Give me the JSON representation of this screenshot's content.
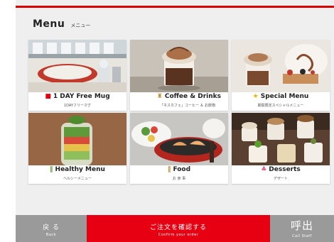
{
  "header": {
    "title": "Menu",
    "subtitle": "メニュー"
  },
  "colors": {
    "accent_red": "#e60012",
    "gray_button": "#9a9a9a"
  },
  "cards": [
    {
      "label": "1 DAY Free Mug",
      "sublabel": "1DAYフリーマグ",
      "icon": "mug-icon"
    },
    {
      "label": "Coffee & Drinks",
      "sublabel": "「ネスカフェ」コーヒー ＆ お飲物",
      "icon": "cup-icon"
    },
    {
      "label": "Special Menu",
      "sublabel": "期間限定スペシャルメニュー",
      "icon": "star-icon"
    },
    {
      "label": "Healthy Menu",
      "sublabel": "ヘルシーメニュー",
      "icon": "leaf-icon"
    },
    {
      "label": "Food",
      "sublabel": "お 食 事",
      "icon": "cutlery-icon"
    },
    {
      "label": "Desserts",
      "sublabel": "デザート",
      "icon": "cake-icon"
    }
  ],
  "footer": {
    "back": {
      "label": "戻 る",
      "sublabel": "Back"
    },
    "confirm": {
      "label": "ご注文を確認する",
      "sublabel": "Confirm your order"
    },
    "call": {
      "label": "呼出",
      "sublabel": "Call Staff"
    }
  }
}
